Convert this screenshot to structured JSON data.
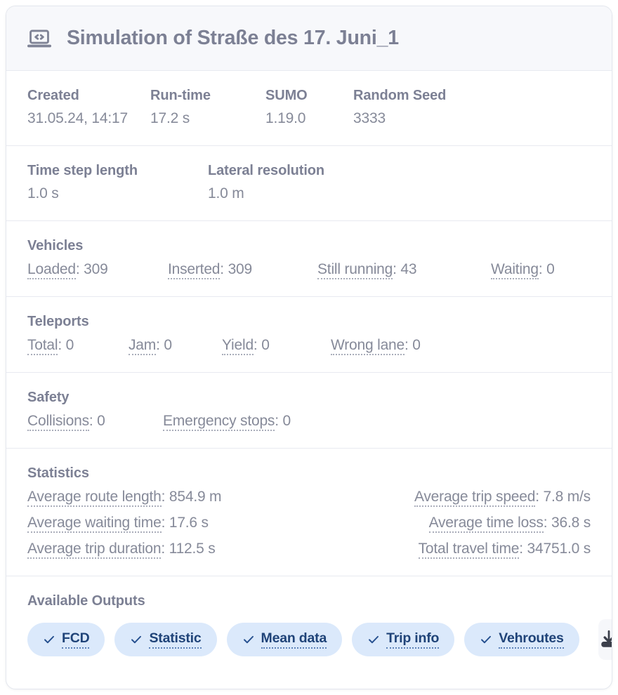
{
  "header": {
    "icon": "laptop-code-icon",
    "title": "Simulation of Straße des 17. Juni_1"
  },
  "meta": {
    "created": {
      "label": "Created",
      "value": "31.05.24, 14:17"
    },
    "runtime": {
      "label": "Run-time",
      "value": "17.2 s"
    },
    "sumo": {
      "label": "SUMO",
      "value": "1.19.0"
    },
    "random_seed": {
      "label": "Random Seed",
      "value": "3333"
    }
  },
  "sim_params": {
    "time_step_length": {
      "label": "Time step length",
      "value": "1.0 s"
    },
    "lateral_resolution": {
      "label": "Lateral resolution",
      "value": "1.0 m"
    }
  },
  "vehicles": {
    "heading": "Vehicles",
    "items": [
      {
        "label": "Loaded",
        "value": "309"
      },
      {
        "label": "Inserted",
        "value": "309"
      },
      {
        "label": "Still running",
        "value": "43"
      },
      {
        "label": "Waiting",
        "value": "0"
      }
    ]
  },
  "teleports": {
    "heading": "Teleports",
    "items": [
      {
        "label": "Total",
        "value": "0"
      },
      {
        "label": "Jam",
        "value": "0"
      },
      {
        "label": "Yield",
        "value": "0"
      },
      {
        "label": "Wrong lane",
        "value": "0"
      }
    ]
  },
  "safety": {
    "heading": "Safety",
    "items": [
      {
        "label": "Collisions",
        "value": "0"
      },
      {
        "label": "Emergency stops",
        "value": "0"
      }
    ]
  },
  "statistics": {
    "heading": "Statistics",
    "left": [
      {
        "label": "Average route length",
        "value": "854.9 m"
      },
      {
        "label": "Average waiting time",
        "value": "17.6 s"
      },
      {
        "label": "Average trip duration",
        "value": "112.5 s"
      }
    ],
    "right": [
      {
        "label": "Average trip speed",
        "value": "7.8 m/s"
      },
      {
        "label": "Average time loss",
        "value": "36.8 s"
      },
      {
        "label": "Total travel time",
        "value": "34751.0 s"
      }
    ]
  },
  "outputs": {
    "heading": "Available Outputs",
    "pills": [
      {
        "label": "FCD",
        "icon": "check-icon"
      },
      {
        "label": "Statistic",
        "icon": "check-icon"
      },
      {
        "label": "Mean data",
        "icon": "check-icon"
      },
      {
        "label": "Trip info",
        "icon": "check-icon"
      },
      {
        "label": "Vehroutes",
        "icon": "check-icon"
      }
    ],
    "download_icon": "download-icon"
  },
  "colors": {
    "card_border": "#e4e7ee",
    "header_bg": "#f7f8fb",
    "divider": "#e8eaf0",
    "heading_text": "#7c8094",
    "value_text": "#868a99",
    "pill_bg": "#dbe9fb",
    "pill_text": "#1f4378",
    "download_icon": "#3b3f4a"
  }
}
